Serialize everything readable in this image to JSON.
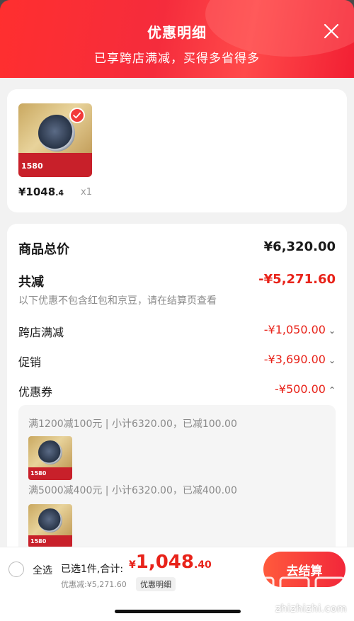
{
  "header": {
    "title": "优惠明细",
    "subtitle": "已享跨店满减，买得多省得多",
    "close_icon": "close-icon"
  },
  "product": {
    "price_int": "¥1048",
    "price_dec": ".4",
    "qty": "x1",
    "thumb_tag": "1580"
  },
  "summary": {
    "total_label": "商品总价",
    "total_value": "¥6,320.00",
    "reduce_label": "共减",
    "reduce_value": "-¥5,271.60",
    "note": "以下优惠不包含红包和京豆，请在结算页查看",
    "items": [
      {
        "label": "跨店满减",
        "value": "-¥1,050.00",
        "chevron": "chevron-down-icon"
      },
      {
        "label": "促销",
        "value": "-¥3,690.00",
        "chevron": "chevron-down-icon"
      },
      {
        "label": "优惠券",
        "value": "-¥500.00",
        "chevron": "chevron-up-icon"
      }
    ]
  },
  "coupons": [
    {
      "text": "满1200减100元 | 小计6320.00，已减100.00",
      "tag": "1580"
    },
    {
      "text": "满5000减400元 | 小计6320.00，已减400.00",
      "tag": "1580"
    }
  ],
  "bottom": {
    "select_all": "全选",
    "selected_text": "已选1件,合计:",
    "total_sym": "¥",
    "total_int": "1,048",
    "total_dec": ".40",
    "saving": "优惠减:¥5,271.60",
    "detail_link": "优惠明细",
    "checkout": "去结算"
  },
  "watermark": "zhizhizhi.com",
  "colors": {
    "accent": "#e8231a",
    "header_start": "#ff2f2f",
    "header_end": "#f21f33"
  }
}
